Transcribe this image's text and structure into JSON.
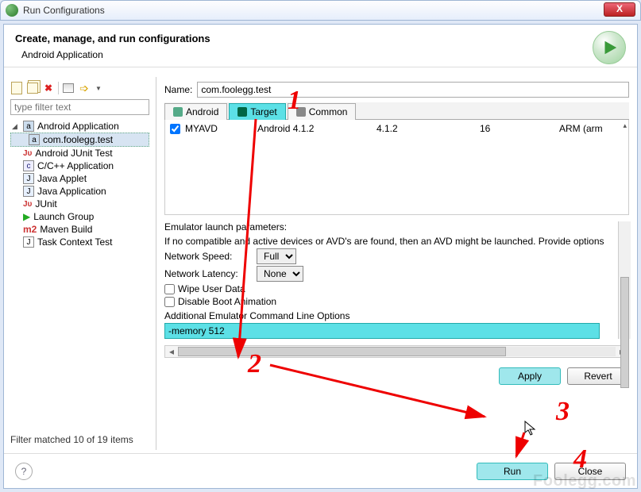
{
  "window": {
    "title": "Run Configurations",
    "close": "X"
  },
  "header": {
    "title": "Create, manage, and run configurations",
    "subtitle": "Android Application"
  },
  "sidebar": {
    "filter_placeholder": "type filter text",
    "items": [
      {
        "label": "Android Application",
        "children": [
          {
            "label": "com.foolegg.test"
          }
        ]
      },
      {
        "label": "Android JUnit Test"
      },
      {
        "label": "C/C++ Application"
      },
      {
        "label": "Java Applet"
      },
      {
        "label": "Java Application"
      },
      {
        "label": "JUnit"
      },
      {
        "label": "Launch Group"
      },
      {
        "label": "Maven Build"
      },
      {
        "label": "Task Context Test"
      }
    ],
    "status": "Filter matched 10 of 19 items"
  },
  "main": {
    "name_label": "Name:",
    "name_value": "com.foolegg.test",
    "tabs": [
      {
        "label": "Android"
      },
      {
        "label": "Target"
      },
      {
        "label": "Common"
      }
    ],
    "avd": {
      "row": {
        "name": "MYAVD",
        "target": "Android 4.1.2",
        "platform": "4.1.2",
        "api": "16",
        "cpu": "ARM (arm"
      }
    },
    "params": {
      "heading": "Emulator launch parameters:",
      "note": "If no compatible and active devices or AVD's are found, then an AVD might be launched. Provide options",
      "netspeed_label": "Network Speed:",
      "netspeed_value": "Full",
      "netlatency_label": "Network Latency:",
      "netlatency_value": "None",
      "wipe_label": "Wipe User Data",
      "disableboot_label": "Disable Boot Animation",
      "cmdline_label": "Additional Emulator Command Line Options",
      "cmdline_value": "-memory 512"
    },
    "buttons": {
      "apply": "Apply",
      "revert": "Revert"
    }
  },
  "footer": {
    "run": "Run",
    "close": "Close"
  },
  "annotations": {
    "n1": "1",
    "n2": "2",
    "n3": "3",
    "n4": "4"
  },
  "watermark": "Foolegg.com"
}
